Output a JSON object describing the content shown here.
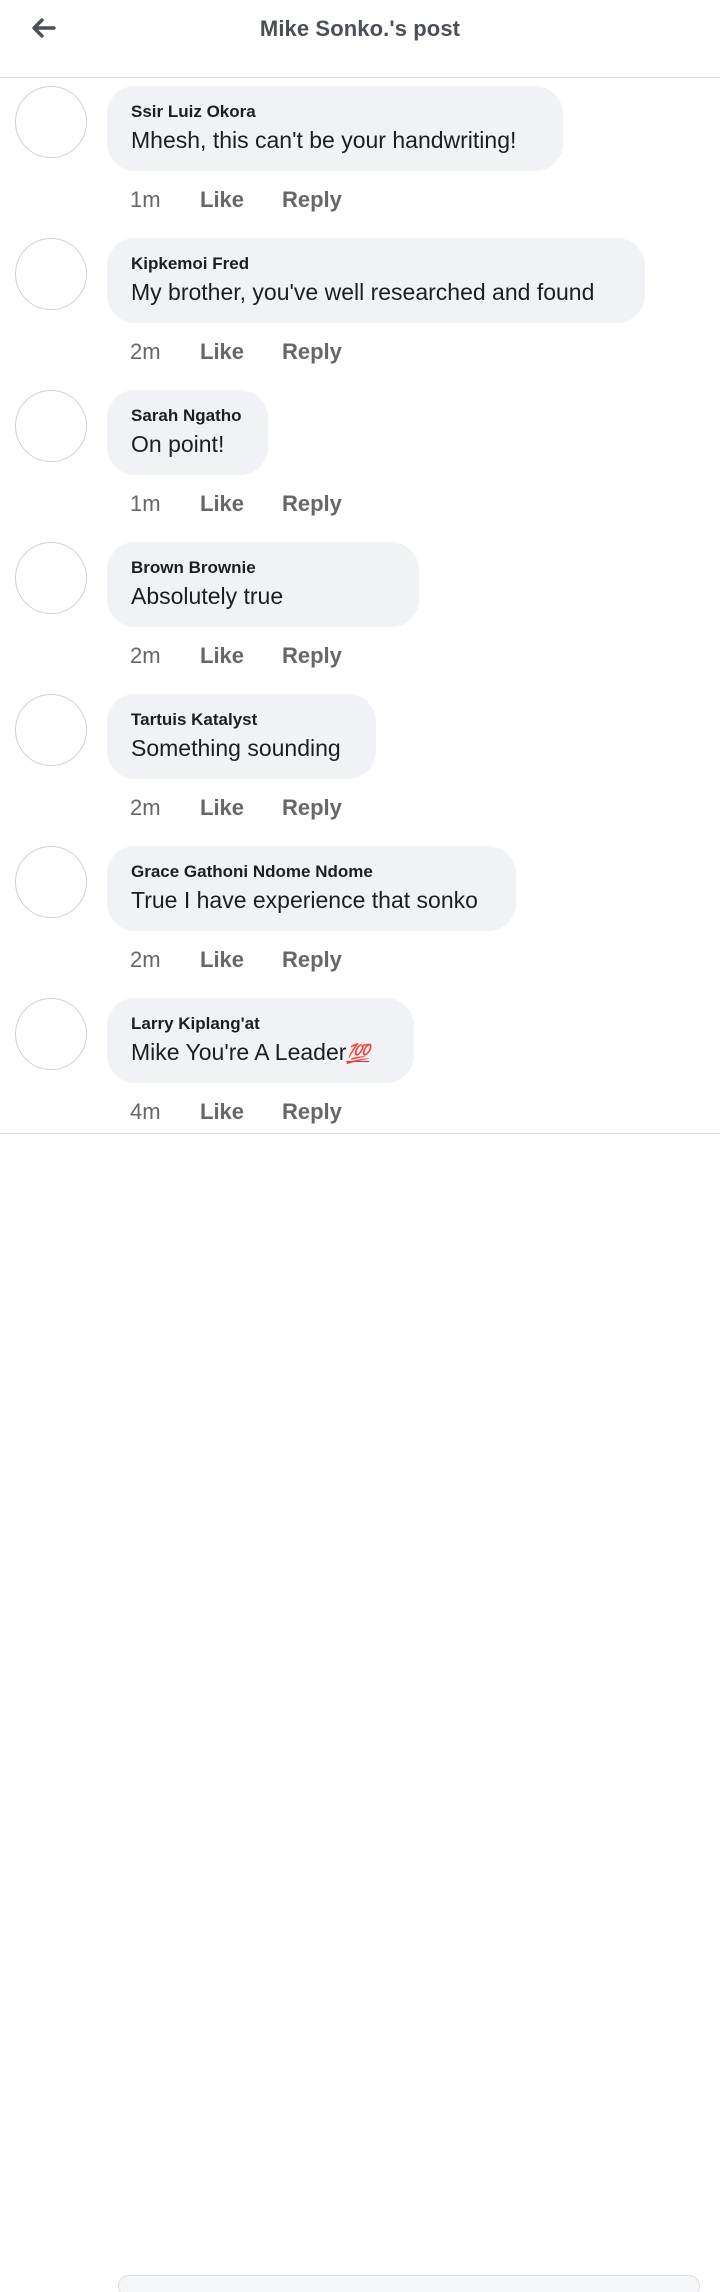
{
  "header": {
    "title": "Mike Sonko.'s post",
    "back_icon": "arrow-left-icon"
  },
  "comments": [
    {
      "author": "Ssir Luiz Okora",
      "text": "Mhesh, this can't be your handwriting!",
      "time": "1m",
      "like": "Like",
      "reply": "Reply"
    },
    {
      "author": "Kipkemoi Fred",
      "text": "My brother, you've well researched and found",
      "time": "2m",
      "like": "Like",
      "reply": "Reply"
    },
    {
      "author": "Sarah Ngatho",
      "text": "On point!",
      "time": "1m",
      "like": "Like",
      "reply": "Reply"
    },
    {
      "author": "Brown Brownie",
      "text": "Absolutely true",
      "time": "2m",
      "like": "Like",
      "reply": "Reply"
    },
    {
      "author": "Tartuis Katalyst",
      "text": "Something sounding",
      "time": "2m",
      "like": "Like",
      "reply": "Reply"
    },
    {
      "author": "Grace Gathoni Ndome Ndome",
      "text": "True I have experience that sonko",
      "time": "2m",
      "like": "Like",
      "reply": "Reply"
    },
    {
      "author": "Larry Kiplang'at",
      "text": "Mike You're A Leader",
      "emoji": "💯",
      "time": "4m",
      "like": "Like",
      "reply": "Reply"
    }
  ],
  "colors": {
    "bubble": "#f0f2f5",
    "meta_text": "#65676b",
    "title_text": "#4b4f56",
    "body_text": "#1c1e21"
  }
}
